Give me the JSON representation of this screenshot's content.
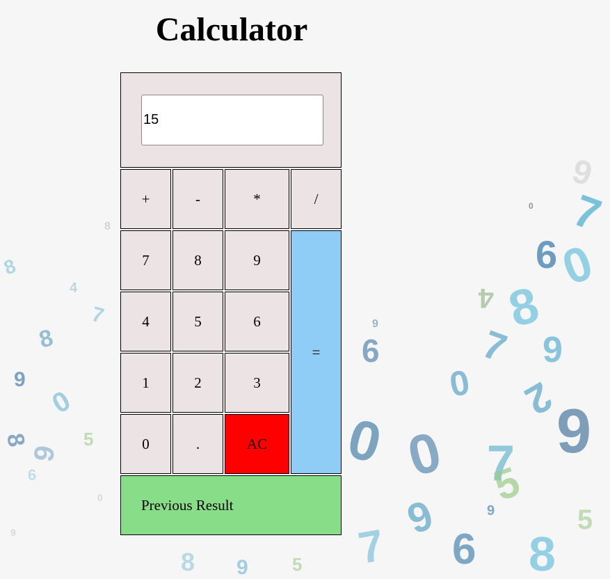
{
  "page": {
    "title": "Calculator"
  },
  "display": {
    "value": "15"
  },
  "operators": [
    "+",
    "-",
    "*",
    "/"
  ],
  "keys": {
    "seven": "7",
    "eight": "8",
    "nine": "9",
    "four": "4",
    "five": "5",
    "six": "6",
    "one": "1",
    "two": "2",
    "three": "3",
    "zero": "0",
    "dot": ".",
    "clear": "AC",
    "equals": "="
  },
  "previous_result": {
    "label": "Previous Result"
  },
  "colors": {
    "key_background": "#ece4e4",
    "equals_background": "#8fcdf7",
    "clear_background": "#ff0000",
    "previous_result_background": "#88dd88",
    "page_background": "#f6f6f7"
  }
}
